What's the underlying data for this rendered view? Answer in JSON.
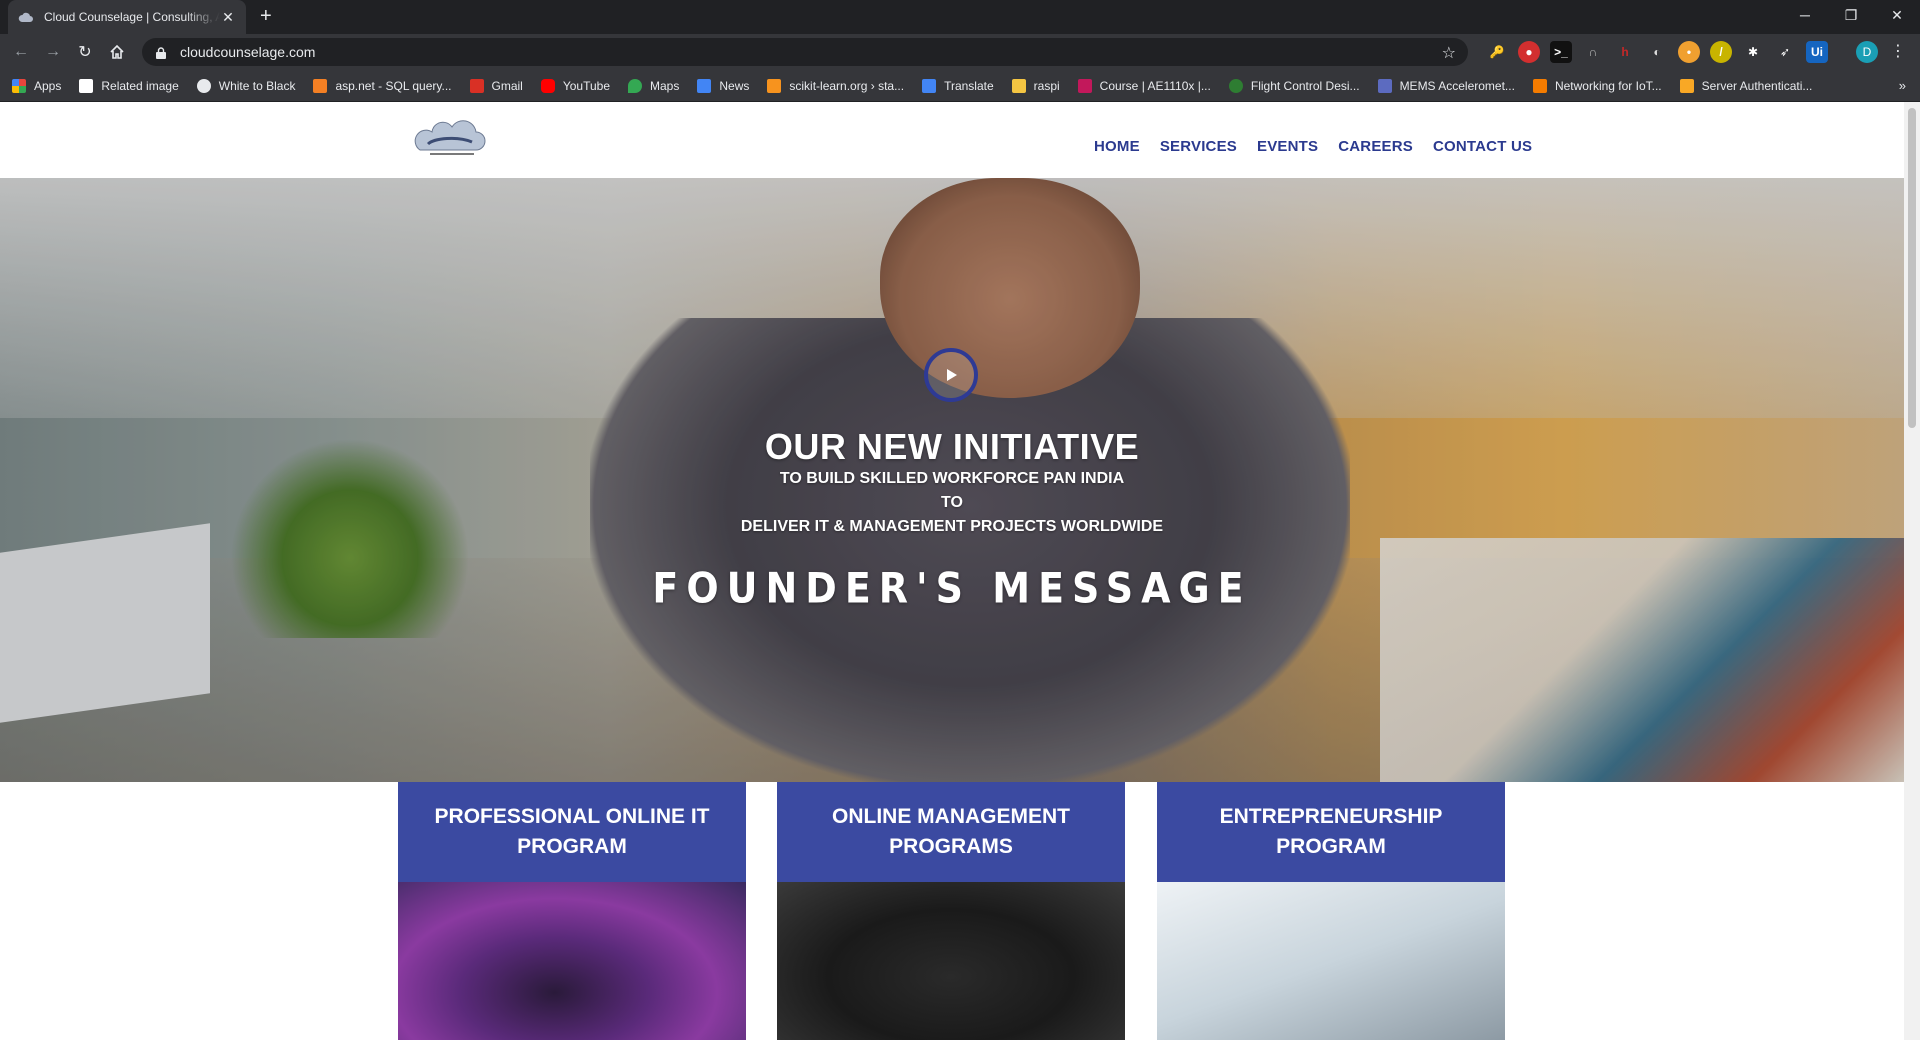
{
  "browser": {
    "tab_title": "Cloud Counselage | Consulting, A",
    "new_tab_symbol": "+",
    "url": "cloudcounselage.com",
    "profile_initial": "D",
    "bookmarks": [
      {
        "label": "Apps",
        "icon": "apps-grid-icon",
        "color": "#e8453c"
      },
      {
        "label": "Related image",
        "icon": "page-icon",
        "color": "#ffffff"
      },
      {
        "label": "White to Black",
        "icon": "globe-icon",
        "color": "#e8eaed"
      },
      {
        "label": "asp.net - SQL query...",
        "icon": "stackoverflow-icon",
        "color": "#f48024"
      },
      {
        "label": "Gmail",
        "icon": "gmail-icon",
        "color": "#d93025"
      },
      {
        "label": "YouTube",
        "icon": "youtube-icon",
        "color": "#ff0000"
      },
      {
        "label": "Maps",
        "icon": "maps-icon",
        "color": "#34a853"
      },
      {
        "label": "News",
        "icon": "news-icon",
        "color": "#4285f4"
      },
      {
        "label": "scikit-learn.org › sta...",
        "icon": "sklearn-icon",
        "color": "#f7931e"
      },
      {
        "label": "Translate",
        "icon": "translate-icon",
        "color": "#4285f4"
      },
      {
        "label": "raspi",
        "icon": "folder-icon",
        "color": "#f4c542"
      },
      {
        "label": "Course | AE1110x |...",
        "icon": "edx-icon",
        "color": "#c2185b"
      },
      {
        "label": "Flight Control Desi...",
        "icon": "coursera-icon",
        "color": "#2e7d32"
      },
      {
        "label": "MEMS Acceleromet...",
        "icon": "ieee-icon",
        "color": "#5c6bc0"
      },
      {
        "label": "Networking for IoT...",
        "icon": "e-icon",
        "color": "#f57c00"
      },
      {
        "label": "Server Authenticati...",
        "icon": "box-icon",
        "color": "#f9a825"
      }
    ],
    "more_bookmarks": "»"
  },
  "site": {
    "nav": [
      "HOME",
      "SERVICES",
      "EVENTS",
      "CAREERS",
      "CONTACT US"
    ],
    "hero": {
      "title": "OUR NEW INITIATIVE",
      "line1": "TO BUILD SKILLED WORKFORCE PAN INDIA",
      "line2": "TO",
      "line3": "DELIVER IT & MANAGEMENT PROJECTS WORLDWIDE",
      "founder": "FOUNDER'S MESSAGE"
    },
    "cards": [
      {
        "title": "PROFESSIONAL ONLINE IT PROGRAM"
      },
      {
        "title": "ONLINE MANAGEMENT PROGRAMS"
      },
      {
        "title": "ENTREPRENEURSHIP PROGRAM"
      }
    ],
    "colors": {
      "brand_blue": "#3b4aa1",
      "nav_blue": "#2b3a8f"
    }
  }
}
